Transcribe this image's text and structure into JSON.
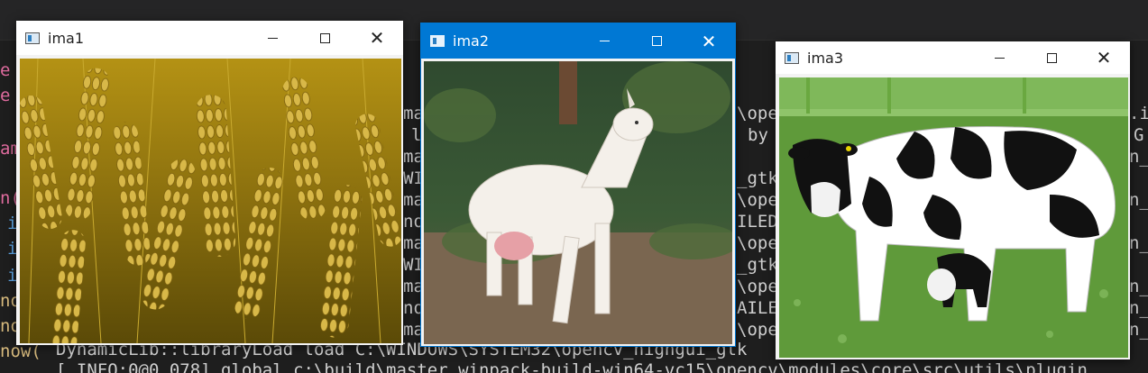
{
  "terminal": {
    "lines": [
      "DynamicLib::libraryLoad load C:\\WINDOWS\\SYSTEM32\\opencv_highgui_gtk",
      "[ INFO:0@0.078] global c:\\build\\master_winpack-build-win64-vc15\\opencv\\modules\\core\\src\\utils\\plugin"
    ],
    "left_edge_fragments": [
      "e",
      "e",
      "am",
      "n(",
      "i",
      "i",
      "i",
      "no",
      "no",
      "now("
    ],
    "column_fragments": [
      "ma",
      "l",
      "ma",
      "WI",
      "ma",
      "no",
      "ma",
      "WI",
      "ma",
      "no",
      "ma"
    ],
    "right_fragments_a": [
      "\\ope",
      "by",
      "_gtk",
      "\\ope",
      "ILED",
      "\\ope",
      "_gtk",
      "\\ope",
      "AILE",
      "\\ope"
    ],
    "right_fragments_b": [
      ".i",
      "G",
      "n_",
      "n_",
      "n_",
      "n_",
      "n_",
      "n_"
    ]
  },
  "windows": [
    {
      "title": "ima1",
      "active": false,
      "image": "wheat-field"
    },
    {
      "title": "ima2",
      "active": true,
      "image": "white-goat"
    },
    {
      "title": "ima3",
      "active": false,
      "image": "holstein-cows"
    }
  ],
  "colors": {
    "terminal_bg": "#1e1e1e",
    "active_titlebar": "#0078d4",
    "keyword_pink": "#e06c9f"
  }
}
